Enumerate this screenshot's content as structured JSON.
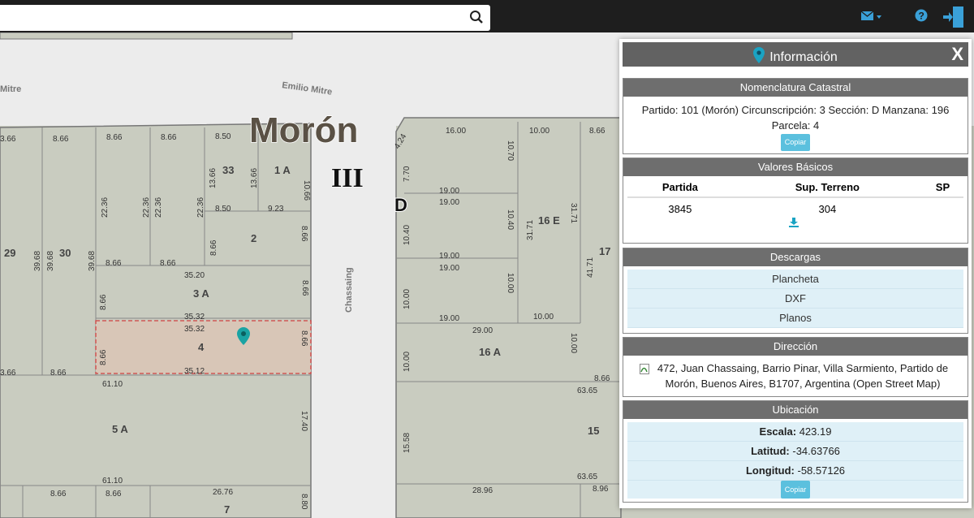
{
  "search": {
    "value": "",
    "placeholder": ""
  },
  "toolbar": {
    "mail_icon": "envelope-icon",
    "help_icon": "question-icon",
    "exit_icon": "exit-door-icon"
  },
  "map": {
    "locality": "Morón",
    "section": "III",
    "manzana_label": "D",
    "streets": {
      "top": "Emilio Mitre",
      "top_left": "Mitre",
      "vertical": "Chassaing"
    },
    "left_parcels": [
      {
        "n": "29"
      },
      {
        "n": "30"
      },
      {
        "n": "33"
      },
      {
        "n": "1 A"
      },
      {
        "n": "2"
      },
      {
        "n": "3 A"
      },
      {
        "n": "4"
      },
      {
        "n": "5 A"
      },
      {
        "n": "7"
      }
    ],
    "right_parcels": [
      {
        "n": "16 E"
      },
      {
        "n": "17"
      },
      {
        "n": "16 A"
      },
      {
        "n": "15"
      }
    ],
    "dims": [
      "3.66",
      "8.66",
      "8.66",
      "8.66",
      "8.50",
      "10.66",
      "13.66",
      "13.66",
      "22.36",
      "22.36",
      "22.36",
      "22.36",
      "8.50",
      "9.23",
      "39.68",
      "39.68",
      "39.68",
      "8.66",
      "8.66",
      "8.66",
      "8.66",
      "35.20",
      "8.66",
      "8.66",
      "35.32",
      "35.32",
      "8.66",
      "8.66",
      "35.12",
      "3.66",
      "8.66",
      "61.10",
      "17.40",
      "61.10",
      "8.66",
      "8.66",
      "26.76",
      "8.80",
      "16.00",
      "10.00",
      "8.66",
      "4.24",
      "10.70",
      "7.70",
      "19.00",
      "19.00",
      "10.40",
      "31.71",
      "31.71",
      "10.40",
      "19.00",
      "19.00",
      "41.71",
      "10.00",
      "10.00",
      "19.00",
      "10.00",
      "29.00",
      "10.00",
      "10.00",
      "8.66",
      "63.65",
      "15.58",
      "63.65",
      "28.96",
      "8.96"
    ]
  },
  "panel": {
    "title": "Información",
    "close": "X",
    "nomenclatura": {
      "header": "Nomenclatura Catastral",
      "text": "Partido: 101 (Morón) Circunscripción: 3 Sección: D Manzana: 196 Parcela: 4",
      "copy": "Copiar"
    },
    "valores": {
      "header": "Valores Básicos",
      "cols": [
        "Partida",
        "Sup. Terreno",
        "SP"
      ],
      "row": [
        "3845",
        "304",
        ""
      ]
    },
    "descargas": {
      "header": "Descargas",
      "items": [
        "Plancheta",
        "DXF",
        "Planos"
      ]
    },
    "direccion": {
      "header": "Dirección",
      "text": "472, Juan Chassaing, Barrio Pinar, Villa Sarmiento, Partido de Morón, Buenos Aires, B1707, Argentina (Open Street Map)"
    },
    "ubicacion": {
      "header": "Ubicación",
      "escala_label": "Escala:",
      "escala": "423.19",
      "lat_label": "Latitud:",
      "lat": "-34.63766",
      "lon_label": "Longitud:",
      "lon": "-58.57126",
      "copy": "Copiar"
    }
  },
  "colors": {
    "parcel": "#c9ccc0",
    "selected": "#d8c6b7",
    "street": "#ececec",
    "accent": "#1aa3a3",
    "header": "#6e6e6e"
  }
}
